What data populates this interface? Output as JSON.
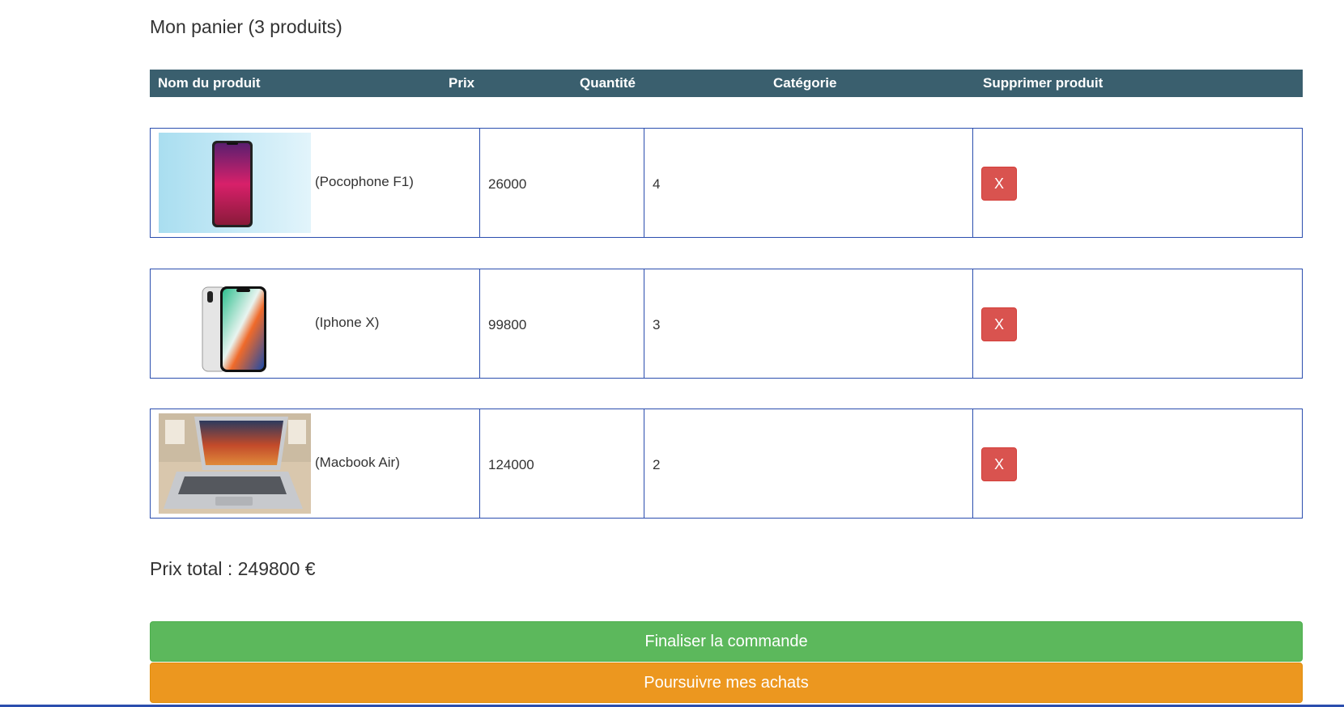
{
  "cart": {
    "title": "Mon panier (3 produits)"
  },
  "table": {
    "headers": {
      "name": "Nom du produit",
      "price": "Prix",
      "quantity": "Quantité",
      "category": "Catégorie",
      "delete": "Supprimer produit"
    },
    "rows": [
      {
        "name": "(Pocophone F1)",
        "price": "26000",
        "quantity": "4",
        "category": "",
        "delete_label": "X"
      },
      {
        "name": "(Iphone X)",
        "price": "99800",
        "quantity": "3",
        "category": "",
        "delete_label": "X"
      },
      {
        "name": "(Macbook Air)",
        "price": "124000",
        "quantity": "2",
        "category": "",
        "delete_label": "X"
      }
    ]
  },
  "total": {
    "text": "Prix total : 249800 €"
  },
  "actions": {
    "finish_label": "Finaliser la commande",
    "continue_label": "Poursuivre mes achats"
  },
  "colors": {
    "header_bg": "#3a5f6e",
    "row_border": "#2b4eae",
    "delete_button": "#d9534f",
    "finish_button": "#5cb85c",
    "continue_button": "#ec971f"
  }
}
